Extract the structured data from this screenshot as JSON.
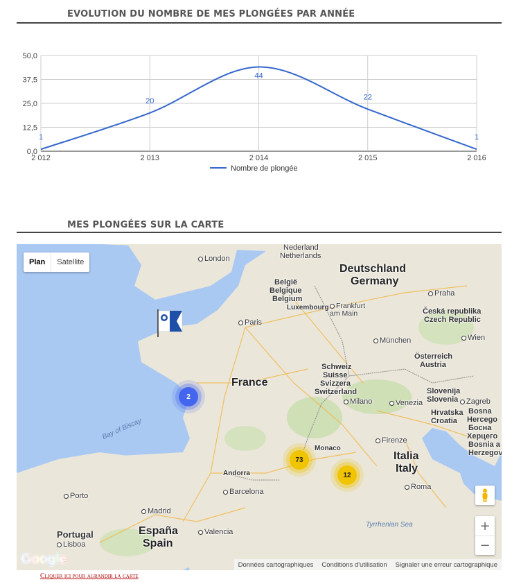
{
  "chart_section": {
    "title": "EVOLUTION DU NOMBRE DE MES PLONGÉES PAR ANNÉE"
  },
  "chart_data": {
    "type": "line",
    "categories": [
      "2 012",
      "2 013",
      "2 014",
      "2 015",
      "2 016"
    ],
    "series": [
      {
        "name": "Nombre de plongée",
        "values": [
          1,
          20,
          44,
          22,
          1
        ],
        "color": "#3366cc"
      }
    ],
    "data_labels": [
      "1",
      "20",
      "44",
      "22",
      "1"
    ],
    "ylim": [
      0,
      50
    ],
    "yticks": [
      "0,0",
      "12,5",
      "25,0",
      "37,5",
      "50,0"
    ],
    "ytick_values": [
      0,
      12.5,
      25,
      37.5,
      50
    ],
    "grid": true,
    "legend_position": "bottom",
    "xlabel": "",
    "ylabel": ""
  },
  "map_section": {
    "title": "MES PLONGÉES SUR LA CARTE"
  },
  "map": {
    "type_control": {
      "plan": "Plan",
      "satellite": "Satellite",
      "active": "Plan"
    },
    "clusters": [
      {
        "count": "2",
        "color": "#4466ee"
      },
      {
        "count": "73",
        "color": "#f0c400"
      },
      {
        "count": "12",
        "color": "#f0c400"
      }
    ],
    "zoom_in": "+",
    "zoom_out": "−",
    "logo": "Google",
    "attribution": {
      "data": "Données cartographiques",
      "terms": "Conditions d'utilisation",
      "report": "Signaler une erreur cartographique"
    },
    "labels": {
      "nederland": "Nederland",
      "netherlands": "Netherlands",
      "london": "London",
      "deutschland": "Deutschland",
      "germany": "Germany",
      "belgie": "België",
      "belgique": "Belgique",
      "belgium": "Belgium",
      "luxembourg": "Luxembourg",
      "frankfurt": "Frankfurt am Main",
      "praha": "Praha",
      "ceska": "Česká republika",
      "czech": "Czech Republic",
      "paris": "Paris",
      "munchen": "München",
      "wien": "Wien",
      "osterreich": "Österreich",
      "austria": "Austria",
      "france": "France",
      "schweiz": "Schweiz",
      "suisse": "Suisse",
      "svizzera": "Svizzera",
      "switzerland": "Switzerland",
      "slovenija": "Slovenija",
      "slovenia": "Slovenia",
      "zagreb": "Zagreb",
      "milano": "Milano",
      "venezia": "Venezia",
      "hrvatska": "Hrvatska",
      "croatia": "Croatia",
      "bosna": "Bosna",
      "hercego": "Hercego",
      "bosnia": "Bosnia",
      "bih_cyr1": "Босна",
      "bih_cyr2": "Херцего",
      "bih_cyr3": "Bosnia a",
      "bih_cyr4": "Herzegovi",
      "bay_of_biscay": "Bay of Biscay",
      "monaco": "Monaco",
      "firenze": "Firenze",
      "italia": "Italia",
      "italy": "Italy",
      "andorra": "Andorra",
      "barcelona": "Barcelona",
      "porto": "Porto",
      "madrid": "Madrid",
      "roma": "Roma",
      "portugal": "Portugal",
      "espana": "España",
      "spain": "Spain",
      "valencia": "Valencia",
      "lisboa": "Lisboa",
      "tyrrhenian": "Tyrrhenian Sea"
    }
  },
  "enlarge_link": "Cliquer ici pour agrandir la carte"
}
